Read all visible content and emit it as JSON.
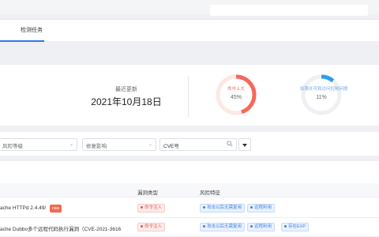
{
  "tabs": [
    {
      "label": "检测任务"
    }
  ],
  "stats": {
    "update_label": "最近更新",
    "update_date": "2021年10月18日",
    "gauges": [
      {
        "label": "命中上大",
        "percent_text": "45%",
        "value": 0.45,
        "color": "#f7685b",
        "track": "#fde8e4"
      },
      {
        "label": "权限许可和访问控制问题",
        "percent_text": "11%",
        "value": 0.11,
        "color": "#2a9df4",
        "track": "#eef0f3"
      }
    ]
  },
  "filters": {
    "risk_level": "风险等级",
    "fix_impact": "修复影响",
    "search_value": "CVE号"
  },
  "table": {
    "columns": [
      "漏洞类型",
      "风险特征"
    ],
    "rows": [
      {
        "name": "ache HTTPd 2.4.49/",
        "badge": "new",
        "type": "命令注入",
        "features": [
          "攻击以后无需复用",
          "远程利用"
        ]
      },
      {
        "name": "ache Dubbo多个远程代码执行漏洞（CVE-2021-3616",
        "type": "命令注入",
        "features": [
          "攻击以后无需复用",
          "远程利用",
          "存在EXP"
        ]
      }
    ]
  }
}
